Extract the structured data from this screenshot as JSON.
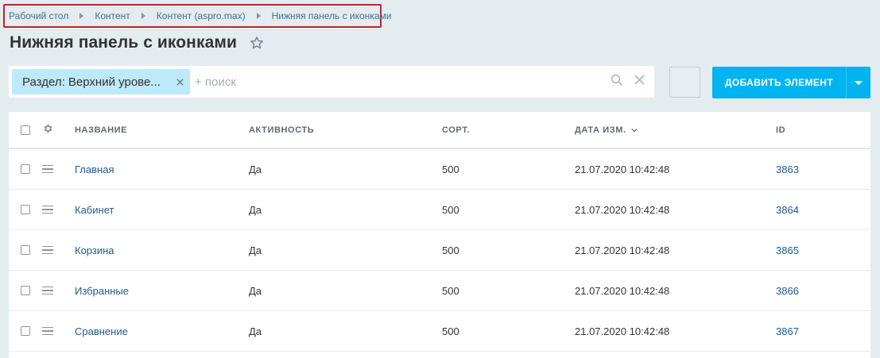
{
  "breadcrumb": [
    "Рабочий стол",
    "Контент",
    "Контент (aspro.max)",
    "Нижняя панель с иконками"
  ],
  "page_title": "Нижняя панель с иконками",
  "filter": {
    "tag_label": "Раздел: Верхний урове...",
    "search_placeholder": "+ поиск"
  },
  "add_button": {
    "label": "Добавить элемент"
  },
  "table": {
    "columns": [
      "Название",
      "Активность",
      "Сорт.",
      "Дата изм.",
      "ID"
    ],
    "rows": [
      {
        "name": "Главная",
        "active": "Да",
        "sort": "500",
        "date": "21.07.2020 10:42:48",
        "id": "3863"
      },
      {
        "name": "Кабинет",
        "active": "Да",
        "sort": "500",
        "date": "21.07.2020 10:42:48",
        "id": "3864"
      },
      {
        "name": "Корзина",
        "active": "Да",
        "sort": "500",
        "date": "21.07.2020 10:42:48",
        "id": "3865"
      },
      {
        "name": "Избранные",
        "active": "Да",
        "sort": "500",
        "date": "21.07.2020 10:42:48",
        "id": "3866"
      },
      {
        "name": "Сравнение",
        "active": "Да",
        "sort": "500",
        "date": "21.07.2020 10:42:48",
        "id": "3867"
      }
    ]
  },
  "colors": {
    "accent": "#00b4f0",
    "link": "#1e5a8f",
    "highlight_frame": "#b7282e",
    "filter_tag": "#bdeaf8"
  }
}
